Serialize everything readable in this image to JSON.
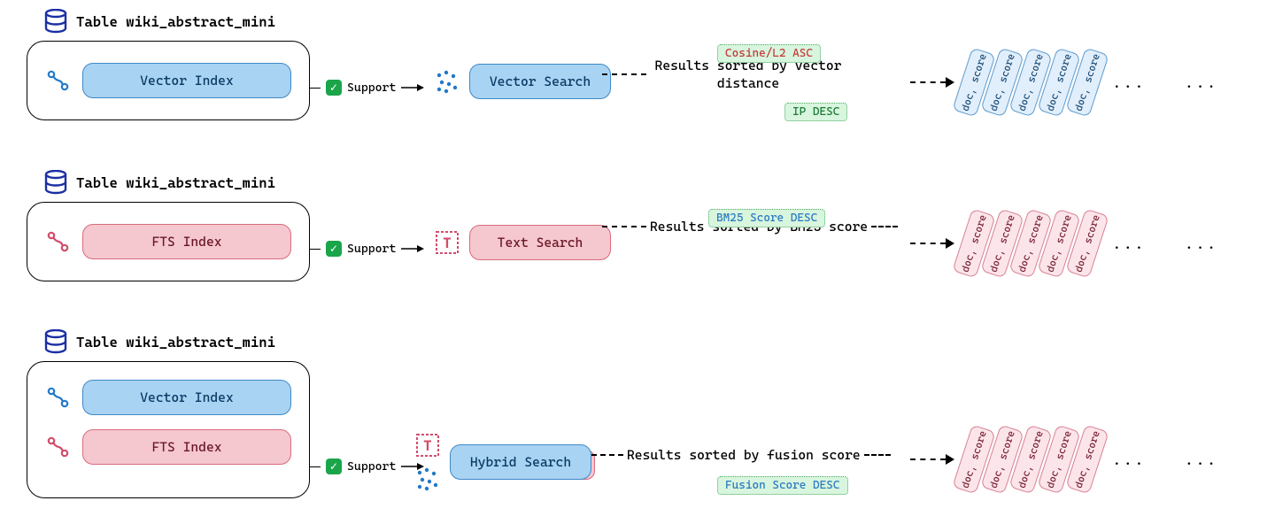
{
  "rows": [
    {
      "table_label": "Table wiki_abstract_mini",
      "indexes": [
        {
          "label": "Vector Index",
          "style": "blue"
        }
      ],
      "support_label": "Support",
      "search_label": "Vector Search",
      "search_style": "blue",
      "result_text": "Results sorted by vector distance",
      "tags": [
        {
          "text": "Cosine/L2 ASC",
          "pos": "top",
          "color": "red"
        },
        {
          "text": "IP DESC",
          "pos": "bottom",
          "color": "green"
        }
      ],
      "doc_label": "doc, score",
      "doc_style": "blue",
      "doc_count": 5,
      "ellipsis": "...",
      "extra_ellipsis": "..."
    },
    {
      "table_label": "Table wiki_abstract_mini",
      "indexes": [
        {
          "label": "FTS Index",
          "style": "pink"
        }
      ],
      "support_label": "Support",
      "search_label": "Text Search",
      "search_style": "pink",
      "result_text": "Results sorted by BM25 score",
      "tags": [
        {
          "text": "BM25 Score DESC",
          "pos": "top",
          "color": "blue"
        }
      ],
      "doc_label": "doc, score",
      "doc_style": "pink",
      "doc_count": 5,
      "ellipsis": "...",
      "extra_ellipsis": "..."
    },
    {
      "table_label": "Table wiki_abstract_mini",
      "indexes": [
        {
          "label": "Vector Index",
          "style": "blue"
        },
        {
          "label": "FTS Index",
          "style": "pink"
        }
      ],
      "support_label": "Support",
      "search_label": "Hybrid Search",
      "search_style": "hybrid",
      "result_text": "Results sorted by fusion score",
      "tags": [
        {
          "text": "Fusion Score DESC",
          "pos": "bottom",
          "color": "blue"
        }
      ],
      "doc_label": "doc, score",
      "doc_style": "pink",
      "doc_count": 5,
      "ellipsis": "...",
      "extra_ellipsis": "..."
    }
  ]
}
